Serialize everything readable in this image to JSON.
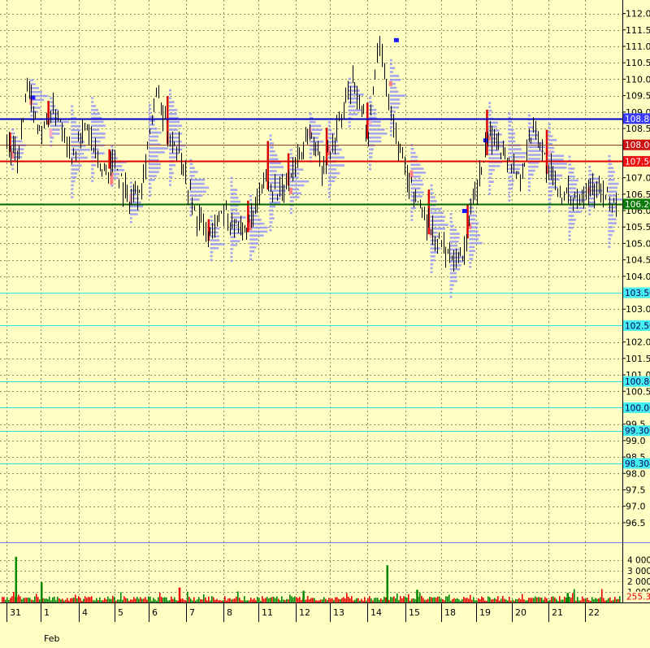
{
  "colors": {
    "background": "#ffffc4",
    "grid": "#8c8c6e",
    "candle": "#000000",
    "profile": "#8a8aff",
    "level_blue": "#0000cc",
    "level_red": "#dd0000",
    "level_brown": "#9b3b2b",
    "level_green": "#006600",
    "level_cyan": "#33e0e0",
    "volume_red": "#ee0000",
    "volume_green": "#008800"
  },
  "chart_data": [
    {
      "type": "line",
      "title": "",
      "xlabel": "",
      "ylabel": "",
      "ylim": [
        96.2,
        112.2
      ],
      "grid": true,
      "y_ticks": [
        "112.0",
        "111.5",
        "111.0",
        "110.5",
        "110.0",
        "109.5",
        "109.0",
        "108.5",
        "107.0",
        "106.5",
        "106.0",
        "105.5",
        "105.0",
        "104.5",
        "104.0",
        "103.0",
        "102.0",
        "101.5",
        "101.0",
        "100.5",
        "99.5",
        "99.0",
        "98.5",
        "98.0",
        "97.5",
        "97.0",
        "96.5"
      ],
      "x_ticks": [
        "31",
        "1",
        "4",
        "5",
        "6",
        "7",
        "8",
        "11",
        "12",
        "13",
        "14",
        "15",
        "18",
        "19",
        "20",
        "21",
        "22"
      ],
      "x_sublabel": "Feb",
      "price_path": [
        [
          0,
          108.1
        ],
        [
          0.3,
          107.5
        ],
        [
          0.6,
          109.6
        ],
        [
          1.0,
          108.4
        ],
        [
          1.4,
          109.1
        ],
        [
          1.8,
          107.7
        ],
        [
          2.2,
          108.6
        ],
        [
          2.6,
          107.2
        ],
        [
          3.0,
          107.5
        ],
        [
          3.4,
          106.3
        ],
        [
          3.8,
          106.9
        ],
        [
          4.2,
          109.6
        ],
        [
          4.5,
          108.3
        ],
        [
          4.8,
          108.0
        ],
        [
          5.2,
          106.0
        ],
        [
          5.6,
          105.2
        ],
        [
          6.0,
          106.1
        ],
        [
          6.4,
          105.3
        ],
        [
          6.8,
          105.6
        ],
        [
          7.2,
          107.0
        ],
        [
          7.6,
          106.4
        ],
        [
          8.0,
          107.5
        ],
        [
          8.4,
          108.4
        ],
        [
          8.8,
          107.3
        ],
        [
          9.2,
          108.5
        ],
        [
          9.6,
          109.9
        ],
        [
          10.0,
          108.4
        ],
        [
          10.3,
          111.2
        ],
        [
          10.7,
          108.5
        ],
        [
          11.0,
          107.2
        ],
        [
          11.4,
          106.1
        ],
        [
          11.8,
          105.2
        ],
        [
          12.2,
          104.7
        ],
        [
          12.6,
          104.6
        ],
        [
          13.0,
          106.6
        ],
        [
          13.4,
          108.4
        ],
        [
          13.8,
          107.8
        ],
        [
          14.2,
          107.0
        ],
        [
          14.6,
          108.6
        ],
        [
          15.0,
          107.2
        ],
        [
          15.4,
          106.4
        ],
        [
          15.8,
          106.5
        ],
        [
          16.2,
          106.8
        ],
        [
          16.5,
          106.4
        ],
        [
          16.9,
          106.2
        ]
      ],
      "levels": [
        {
          "label": "108.80",
          "value": 108.8,
          "style": "blue"
        },
        {
          "label": "108.00",
          "value": 108.0,
          "style": "brown"
        },
        {
          "label": "107.50",
          "value": 107.5,
          "style": "red"
        },
        {
          "label": "106.20",
          "value": 106.2,
          "style": "green"
        },
        {
          "label": "103.50",
          "value": 103.5,
          "style": "cyan"
        },
        {
          "label": "102.50",
          "value": 102.5,
          "style": "cyan"
        },
        {
          "label": "100.80",
          "value": 100.8,
          "style": "cyan"
        },
        {
          "label": "100.00",
          "value": 100.0,
          "style": "cyan"
        },
        {
          "label": "99.300",
          "value": 99.3,
          "style": "cyan"
        },
        {
          "label": "98.304",
          "value": 98.304,
          "style": "cyan"
        }
      ]
    },
    {
      "type": "bar",
      "title": "",
      "ylim": [
        0,
        5200
      ],
      "y_ticks": [
        "4 000",
        "3 000",
        "2 000",
        "1 000"
      ],
      "last_label": "255.32",
      "peaks": [
        {
          "x": 0.25,
          "value": 4300,
          "color": "green"
        },
        {
          "x": 1.0,
          "value": 1900,
          "color": "green"
        },
        {
          "x": 4.8,
          "value": 1400,
          "color": "red"
        },
        {
          "x": 8.2,
          "value": 1100,
          "color": "green"
        },
        {
          "x": 10.5,
          "value": 3500,
          "color": "green"
        },
        {
          "x": 11.3,
          "value": 1200,
          "color": "green"
        },
        {
          "x": 15.5,
          "value": 900,
          "color": "green"
        }
      ]
    }
  ]
}
